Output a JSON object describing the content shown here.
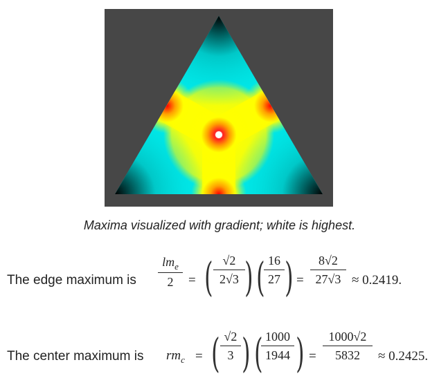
{
  "figure": {
    "caption": "Maxima visualized with gradient; white is highest."
  },
  "edge_line": {
    "lead": "The edge maximum is",
    "lhs_num": "lm",
    "lhs_sub": "e",
    "lhs_den": "2",
    "eq1": "=",
    "f1_num": "√2",
    "f1_den": "2√3",
    "f2_num": "16",
    "f2_den": "27",
    "eq2": "=",
    "f3_num": "8√2",
    "f3_den": "27√3",
    "approx": "≈ 0.2419."
  },
  "center_line": {
    "lead": "The center maximum is",
    "lhs": "rm",
    "lhs_sub": "c",
    "eq1": "=",
    "f1_num": "√2",
    "f1_den": "3",
    "f2_num": "1000",
    "f2_den": "1944",
    "eq2": "=",
    "f3_num": "1000√2",
    "f3_den": "5832",
    "approx": "≈ 0.2425."
  },
  "colors": {
    "panel_bg": "#474747",
    "gradient_low": "#000000",
    "gradient_mid_low": "#00e5e5",
    "gradient_mid": "#ffff00",
    "gradient_high": "#ff0000",
    "gradient_max": "#ffffff"
  }
}
